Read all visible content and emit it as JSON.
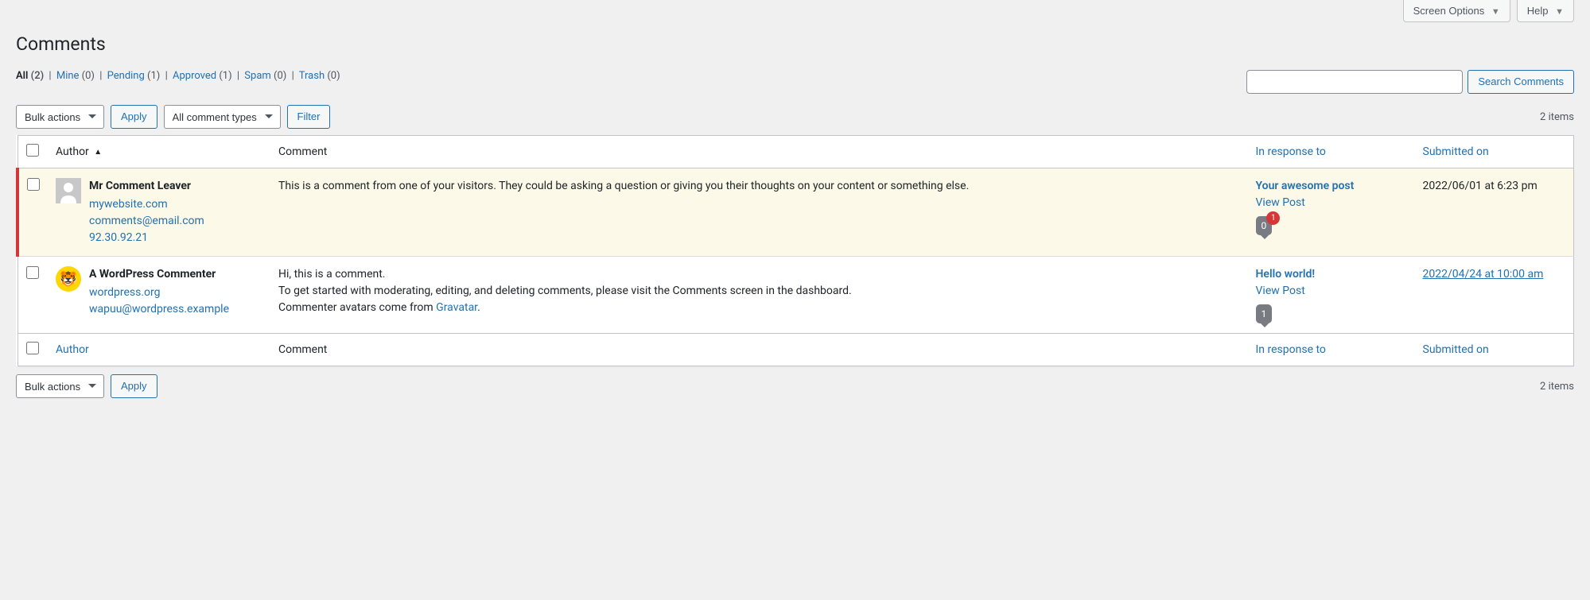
{
  "topTabs": {
    "screenOptions": "Screen Options",
    "help": "Help"
  },
  "pageTitle": "Comments",
  "filters": {
    "all": {
      "label": "All",
      "count": "(2)"
    },
    "mine": {
      "label": "Mine",
      "count": "(0)"
    },
    "pending": {
      "label": "Pending",
      "count": "(1)"
    },
    "approved": {
      "label": "Approved",
      "count": "(1)"
    },
    "spam": {
      "label": "Spam",
      "count": "(0)"
    },
    "trash": {
      "label": "Trash",
      "count": "(0)"
    }
  },
  "search": {
    "button": "Search Comments"
  },
  "bulkActions": "Bulk actions",
  "applyLabel": "Apply",
  "commentTypes": "All comment types",
  "filterLabel": "Filter",
  "itemCount": "2 items",
  "columns": {
    "author": "Author",
    "comment": "Comment",
    "response": "In response to",
    "date": "Submitted on"
  },
  "rows": [
    {
      "status": "unapproved",
      "avatar": "generic",
      "authorName": "Mr Comment Leaver",
      "authorUrl": "mywebsite.com",
      "authorEmail": "comments@email.com",
      "authorIp": "92.30.92.21",
      "commentLines": [
        "This is a comment from one of your visitors. They could be asking a question or giving you their thoughts on your content or something else."
      ],
      "postTitle": "Your awesome post",
      "viewPost": "View Post",
      "bubbleCount": "0",
      "pendingCount": "1",
      "date": "2022/06/01 at 6:23 pm",
      "dateLink": false
    },
    {
      "status": "approved",
      "avatar": "wapuu",
      "authorName": "A WordPress Commenter",
      "authorUrl": "wordpress.org",
      "authorEmail": "wapuu@wordpress.example",
      "authorIp": "",
      "commentLines": [
        "Hi, this is a comment.",
        "To get started with moderating, editing, and deleting comments, please visit the Comments screen in the dashboard.",
        "Commenter avatars come from "
      ],
      "commentTrailingLink": "Gravatar",
      "commentTrailingSuffix": ".",
      "postTitle": "Hello world!",
      "viewPost": "View Post",
      "bubbleCount": "1",
      "pendingCount": "",
      "date": "2022/04/24 at 10:00 am",
      "dateLink": true
    }
  ]
}
